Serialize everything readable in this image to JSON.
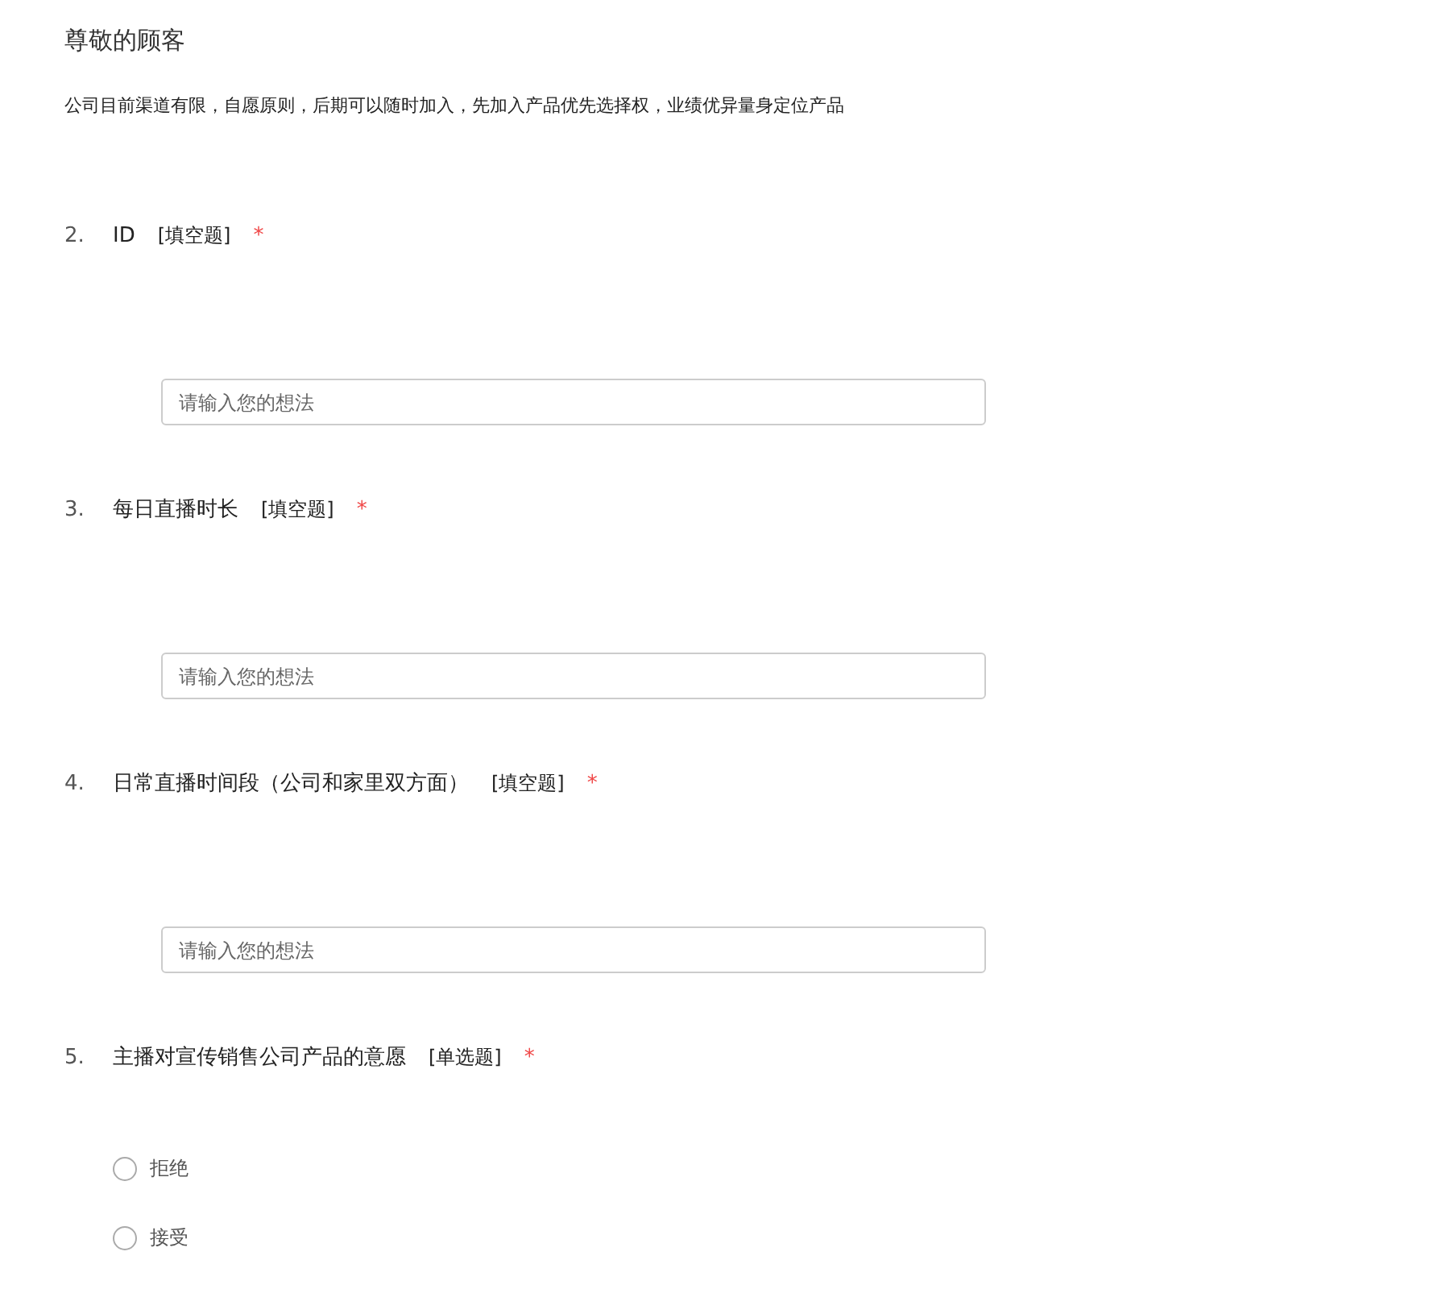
{
  "survey": {
    "title": "尊敬的顾客",
    "intro": "公司目前渠道有限，自愿原则，后期可以随时加入，先加入产品优先选择权，业绩优异量身定位产品"
  },
  "questions": [
    {
      "number": "2.",
      "title": "ID",
      "type_label": "[填空题]",
      "required_mark": "*",
      "kind": "text",
      "placeholder": "请输入您的想法"
    },
    {
      "number": "3.",
      "title": "每日直播时长",
      "type_label": "[填空题]",
      "required_mark": "*",
      "kind": "text",
      "placeholder": "请输入您的想法"
    },
    {
      "number": "4.",
      "title": "日常直播时间段（公司和家里双方面）",
      "type_label": "[填空题]",
      "required_mark": "*",
      "kind": "text",
      "placeholder": "请输入您的想法"
    },
    {
      "number": "5.",
      "title": "主播对宣传销售公司产品的意愿",
      "type_label": "[单选题]",
      "required_mark": "*",
      "kind": "radio",
      "options": [
        {
          "label": "拒绝",
          "selected": false
        },
        {
          "label": "接受",
          "selected": false
        }
      ]
    }
  ]
}
